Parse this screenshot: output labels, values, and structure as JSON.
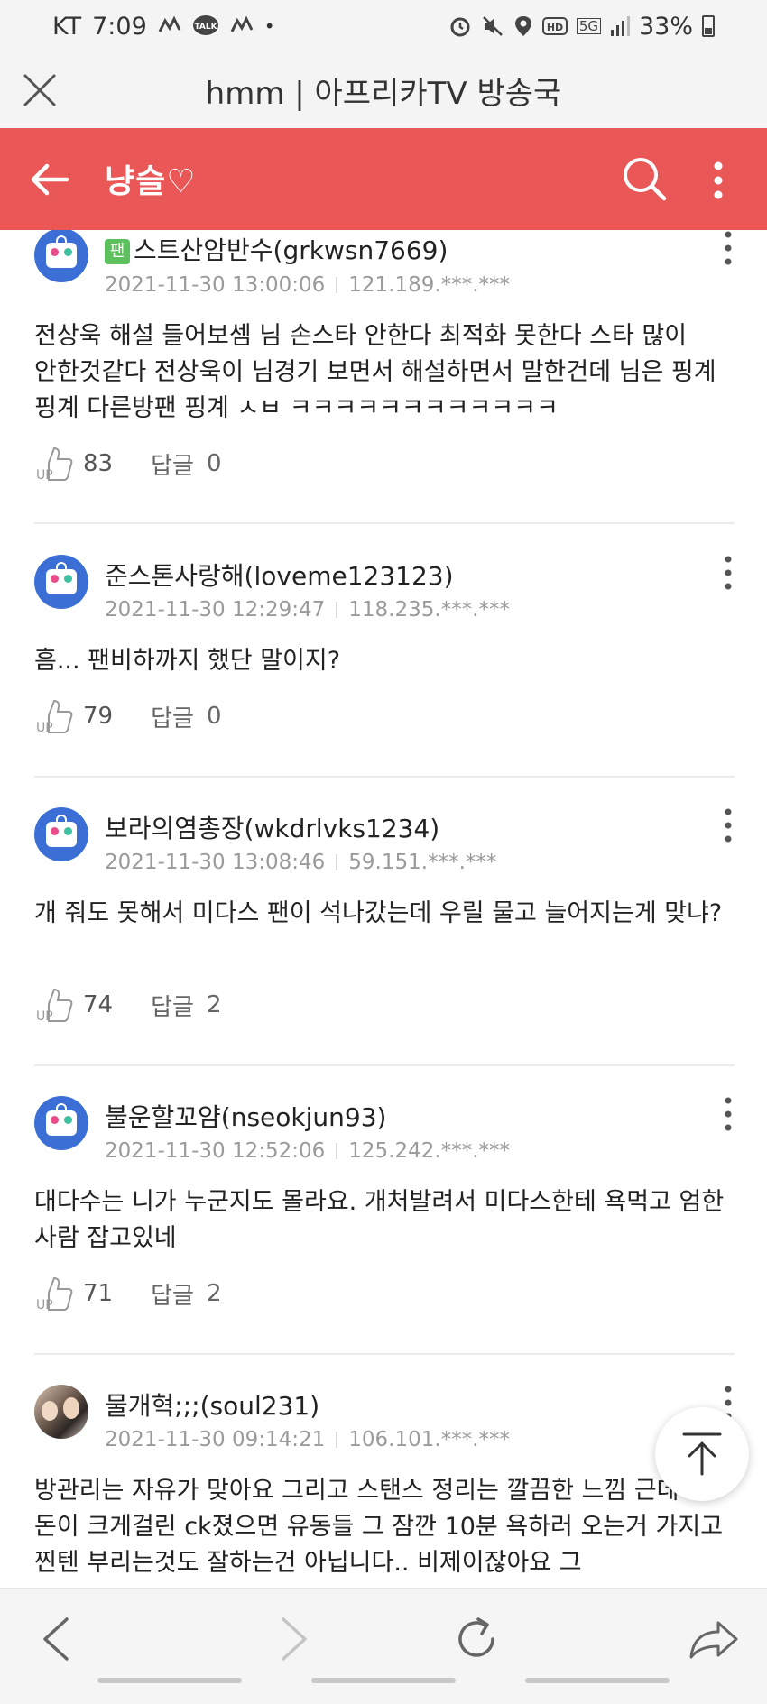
{
  "status_bar": {
    "carrier": "KT",
    "time": "7:09",
    "dot": "•",
    "network": "5G",
    "battery": "33%",
    "icons": [
      "notification-icon",
      "kakaotalk-icon",
      "notification-icon",
      "alarm-icon",
      "mute-icon",
      "location-icon",
      "hd-icon",
      "network-5g-icon",
      "signal-icon",
      "battery-icon"
    ]
  },
  "browser": {
    "title": "hmm | 아프리카TV 방송국"
  },
  "header": {
    "title": "냥슬♡",
    "background": "#ea5757"
  },
  "comments": [
    {
      "fan_badge": "팬",
      "nickname": "스트산암반수(grkwsn7669)",
      "date": "2021-11-30 13:00:06",
      "ip": "121.189.***.***",
      "body": "전상욱 해설 들어보셈 님 손스타 안한다 최적화 못한다 스타 많이 안한것같다 전상욱이 님경기 보면서 해설하면서 말한건데 님은 핑계 핑계 다른방팬 핑계 ㅅㅂ ㅋㅋㅋㅋㅋㅋㅋㅋㅋㅋㅋㅋ",
      "up_label": "UP",
      "likes": "83",
      "reply_label": "답글",
      "replies": "0"
    },
    {
      "nickname": "준스톤사랑해(loveme123123)",
      "date": "2021-11-30 12:29:47",
      "ip": "118.235.***.***",
      "body": "흠... 팬비하까지 했단 말이지?",
      "up_label": "UP",
      "likes": "79",
      "reply_label": "답글",
      "replies": "0"
    },
    {
      "nickname": "보라의염총장(wkdrlvks1234)",
      "date": "2021-11-30 13:08:46",
      "ip": "59.151.***.***",
      "body": "개 줘도 못해서 미다스 팬이 석나갔는데 우릴 물고 늘어지는게 맞냐?",
      "up_label": "UP",
      "likes": "74",
      "reply_label": "답글",
      "replies": "2"
    },
    {
      "nickname": "불운할꼬얌(nseokjun93)",
      "date": "2021-11-30 12:52:06",
      "ip": "125.242.***.***",
      "body": "대다수는 니가 누군지도 몰라요. 개처발려서 미다스한테 욕먹고 엄한 사람 잡고있네",
      "up_label": "UP",
      "likes": "71",
      "reply_label": "답글",
      "replies": "2"
    },
    {
      "nickname": "물개혁;;;(soul231)",
      "date": "2021-11-30 09:14:21",
      "ip": "106.101.***.***",
      "body": "방관리는 자유가 맞아요 그리고 스탠스 정리는 깔끔한 느낌 근데 만 돈이 크게걸린 ck졌으면 유동들 그 잠깐 10분 욕하러 오는거 가지고 찐텐 부리는것도 잘하는건 아닙니다.. 비제이잖아요 그"
    }
  ]
}
